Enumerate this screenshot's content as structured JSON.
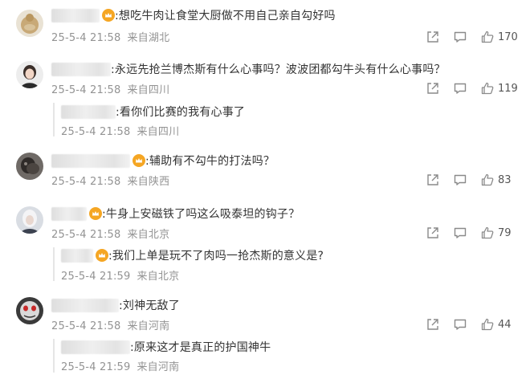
{
  "comments": [
    {
      "username": "",
      "text": ":想吃牛肉让食堂大厨做不用自己亲自勾好吗",
      "date": "25-5-4 21:58",
      "location": "来自湖北",
      "likes": "170",
      "replies": []
    },
    {
      "username": "",
      "text": ":永远先抢兰博杰斯有什么心事吗？波波团都勾牛头有什么心事吗？",
      "date": "25-5-4 21:58",
      "location": "来自四川",
      "likes": "119",
      "replies": [
        {
          "username": "",
          "text": ":看你们比赛的我有心事了",
          "date": "25-5-4 21:58",
          "location": "来自四川"
        }
      ]
    },
    {
      "username": "",
      "text": ":辅助有不勾牛的打法吗？",
      "date": "25-5-4 21:58",
      "location": "来自陕西",
      "likes": "83",
      "replies": []
    },
    {
      "username": "",
      "text": ":牛身上安磁铁了吗这么吸泰坦的钩子？",
      "date": "25-5-4 21:58",
      "location": "来自北京",
      "likes": "79",
      "replies": [
        {
          "username": "",
          "text": ":我们上单是玩不了肉吗一抢杰斯的意义是?",
          "date": "25-5-4 21:59",
          "location": "来自北京"
        }
      ]
    },
    {
      "username": "",
      "text": ":刘神无敌了",
      "date": "25-5-4 21:58",
      "location": "来自河南",
      "likes": "44",
      "replies": [
        {
          "username": "",
          "text": ":原来这才是真正的护国神牛",
          "date": "25-5-4 21:59",
          "location": "来自河南"
        }
      ]
    }
  ],
  "icons": {
    "share": "share-icon",
    "comment": "comment-icon",
    "like": "thumbs-up-icon",
    "badge": "crown-badge-icon"
  },
  "colors": {
    "text": "#333333",
    "meta": "#939393",
    "icon": "#8a8a8a",
    "badge": "#f5a623"
  }
}
